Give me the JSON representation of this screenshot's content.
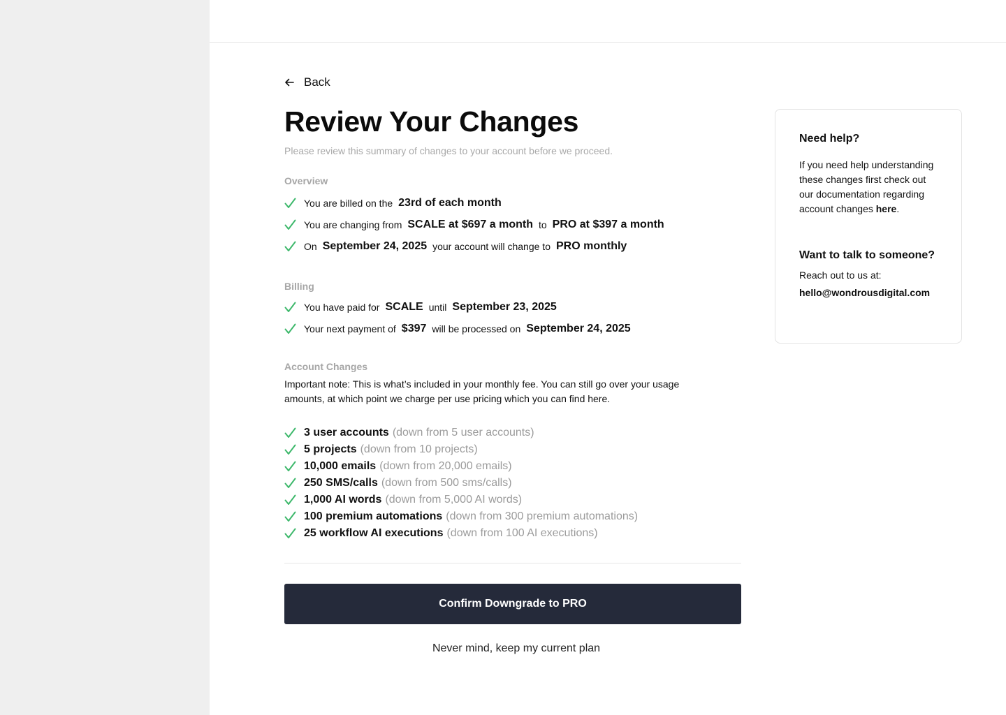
{
  "nav": {
    "back_label": "Back"
  },
  "page": {
    "title": "Review Your Changes",
    "subtitle": "Please review this summary of changes to your account before we proceed."
  },
  "overview": {
    "label": "Overview",
    "row1": {
      "t1": "You are billed on the",
      "b1": "23rd of each month"
    },
    "row2": {
      "t1": "You are changing from",
      "b1": "SCALE at $697 a month",
      "t2": "to",
      "b2": "PRO at $397 a month"
    },
    "row3": {
      "t1": "On",
      "b1": "September 24, 2025",
      "t2": "your account will change to",
      "b2": "PRO monthly"
    }
  },
  "billing": {
    "label": "Billing",
    "row1": {
      "t1": "You have paid for",
      "b1": "SCALE",
      "t2": "until",
      "b2": "September 23, 2025"
    },
    "row2": {
      "t1": "Your next payment of",
      "b1": "$397",
      "t2": "will be processed on",
      "b2": "September 24, 2025"
    }
  },
  "account_changes": {
    "label": "Account Changes",
    "note": "Important note: This is what’s included in your monthly fee. You can still go over your usage amounts, at which point we charge per use pricing which you can find here.",
    "items": [
      {
        "bold": "3 user accounts",
        "detail": "(down from 5 user accounts)"
      },
      {
        "bold": "5 projects",
        "detail": "(down from 10 projects)"
      },
      {
        "bold": "10,000 emails",
        "detail": "(down from 20,000 emails)"
      },
      {
        "bold": "250 SMS/calls",
        "detail": "(down from 500 sms/calls)"
      },
      {
        "bold": "1,000 AI words",
        "detail": "(down from 5,000 AI words)"
      },
      {
        "bold": "100 premium automations",
        "detail": "(down from 300 premium automations)"
      },
      {
        "bold": "25 workflow AI executions",
        "detail": "(down from 100 AI executions)"
      }
    ]
  },
  "actions": {
    "confirm_label": "Confirm Downgrade to PRO",
    "keep_label": "Never mind, keep my current plan"
  },
  "help": {
    "title": "Need help?",
    "body": "If you need help understanding these changes first check out our documentation regarding account changes",
    "link_label": "here",
    "period": ".",
    "talk_title": "Want to talk to someone?",
    "talk_body": "Reach out to us at:",
    "email": "hello@wondrousdigital.com"
  },
  "colors": {
    "check_green": "#3db86b",
    "button_bg": "#252a3a",
    "sidebar_bg": "#efefef",
    "muted_text": "#a6a6a6"
  },
  "icons": {
    "back": "arrow-left-icon",
    "check": "check-icon"
  }
}
